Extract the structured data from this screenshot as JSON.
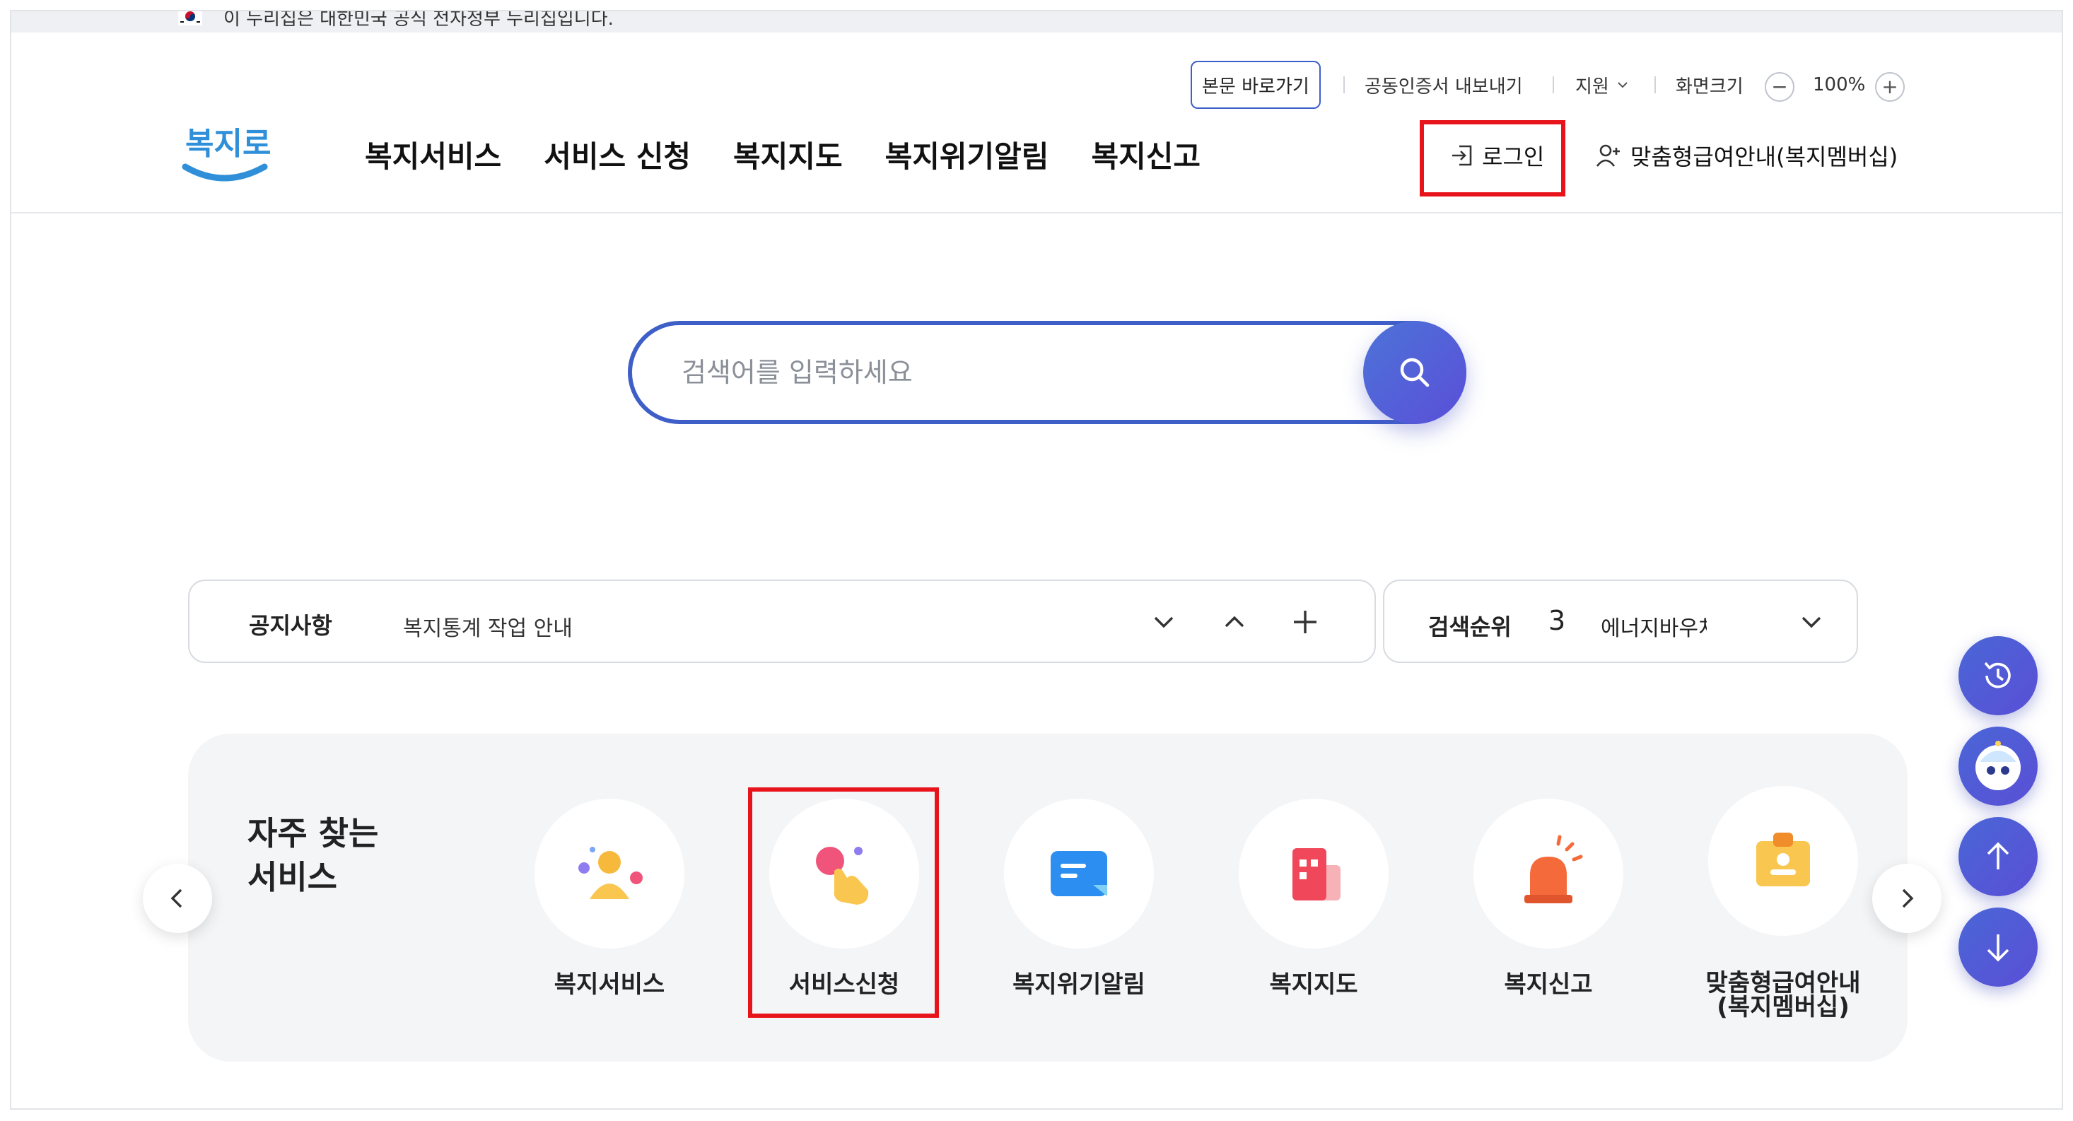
{
  "gov_banner": {
    "text": "이 누리집은 대한민국 공식 전자정부 누리집입니다."
  },
  "header": {
    "logo_text": "복지로",
    "utility": {
      "skip_link": "본문 바로가기",
      "cert_export": "공동인증서 내보내기",
      "support": "지원",
      "screen_size_label": "화면크기",
      "zoom_out": "−",
      "zoom_level": "100%",
      "zoom_in": "+"
    },
    "nav": [
      "복지서비스",
      "서비스 신청",
      "복지지도",
      "복지위기알림",
      "복지신고"
    ],
    "login": "로그인",
    "membership": "맞춤형급여안내(복지멤버십)"
  },
  "search": {
    "placeholder": "검색어를 입력하세요"
  },
  "notice": {
    "label": "공지사항",
    "text": "복지통계 작업 안내"
  },
  "ranking": {
    "label": "검색순위",
    "rank": "3",
    "keyword": "에너지바우처"
  },
  "frequent": {
    "title": "자주 찾는\n서비스",
    "items": [
      {
        "label": "복지서비스",
        "icon": "people-icon"
      },
      {
        "label": "서비스신청",
        "icon": "hand-tap-icon"
      },
      {
        "label": "복지위기알림",
        "icon": "message-icon"
      },
      {
        "label": "복지지도",
        "icon": "building-map-icon"
      },
      {
        "label": "복지신고",
        "icon": "siren-icon"
      },
      {
        "label": "맞춤형급여안내\n(복지멤버십)",
        "icon": "id-badge-icon"
      }
    ]
  },
  "colors": {
    "brand_blue": "#3e5ec8",
    "highlight_red": "#e8141b",
    "fab_purple": "#5a4fd6"
  }
}
